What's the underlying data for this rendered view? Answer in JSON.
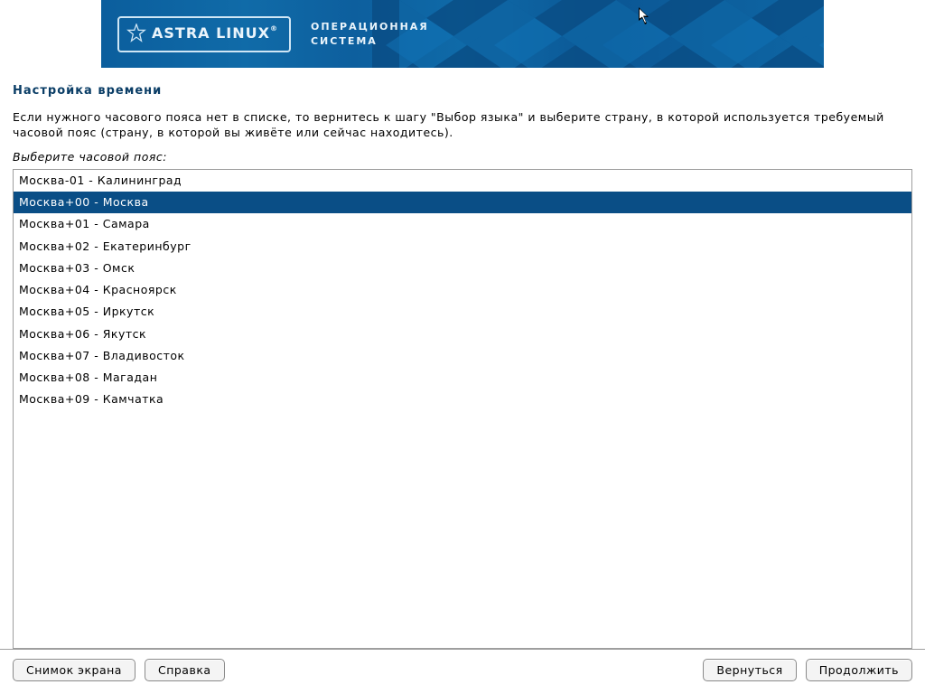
{
  "banner": {
    "brand": "ASTRA LINUX",
    "trademark": "®",
    "subtitle_line1": "ОПЕРАЦИОННАЯ",
    "subtitle_line2": "СИСТЕМА"
  },
  "page_title": "Настройка времени",
  "description": "Если нужного часового пояса нет в списке, то вернитесь к шагу \"Выбор языка\" и выберите страну, в которой используется требуемый часовой пояс (страну, в которой вы живёте или сейчас находитесь).",
  "list_label": "Выберите часовой пояс:",
  "timezones": [
    "Москва-01 - Калининград",
    "Москва+00 - Москва",
    "Москва+01 - Самара",
    "Москва+02 - Екатеринбург",
    "Москва+03 - Омск",
    "Москва+04 - Красноярск",
    "Москва+05 - Иркутск",
    "Москва+06 - Якутск",
    "Москва+07 - Владивосток",
    "Москва+08 - Магадан",
    "Москва+09 - Камчатка"
  ],
  "selected_index": 1,
  "buttons": {
    "screenshot": "Снимок экрана",
    "help": "Справка",
    "back": "Вернуться",
    "continue": "Продолжить"
  }
}
